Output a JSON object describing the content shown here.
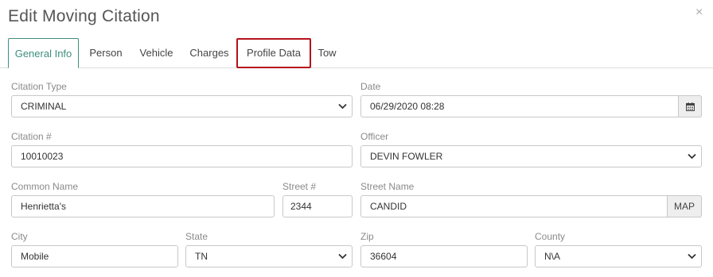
{
  "dialog": {
    "title": "Edit Moving Citation",
    "close_glyph": "×"
  },
  "tabs": [
    {
      "label": "General Info",
      "active": true
    },
    {
      "label": "Person"
    },
    {
      "label": "Vehicle"
    },
    {
      "label": "Charges"
    },
    {
      "label": "Profile Data",
      "highlighted": true
    },
    {
      "label": "Tow"
    }
  ],
  "form": {
    "citation_type": {
      "label": "Citation Type",
      "value": "CRIMINAL"
    },
    "date": {
      "label": "Date",
      "value": "06/29/2020 08:28",
      "icon": "calendar-icon"
    },
    "citation_number": {
      "label": "Citation #",
      "value": "10010023"
    },
    "officer": {
      "label": "Officer",
      "value": "DEVIN FOWLER"
    },
    "common_name": {
      "label": "Common Name",
      "value": "Henrietta's"
    },
    "street_number": {
      "label": "Street #",
      "value": "2344"
    },
    "street_name": {
      "label": "Street Name",
      "value": "CANDID",
      "button": "MAP"
    },
    "city": {
      "label": "City",
      "value": "Mobile"
    },
    "state": {
      "label": "State",
      "value": "TN"
    },
    "zip": {
      "label": "Zip",
      "value": "36604"
    },
    "county": {
      "label": "County",
      "value": "N\\A"
    }
  },
  "colors": {
    "active_tab": "#3e8e7e",
    "highlight_border": "#b5121b"
  }
}
